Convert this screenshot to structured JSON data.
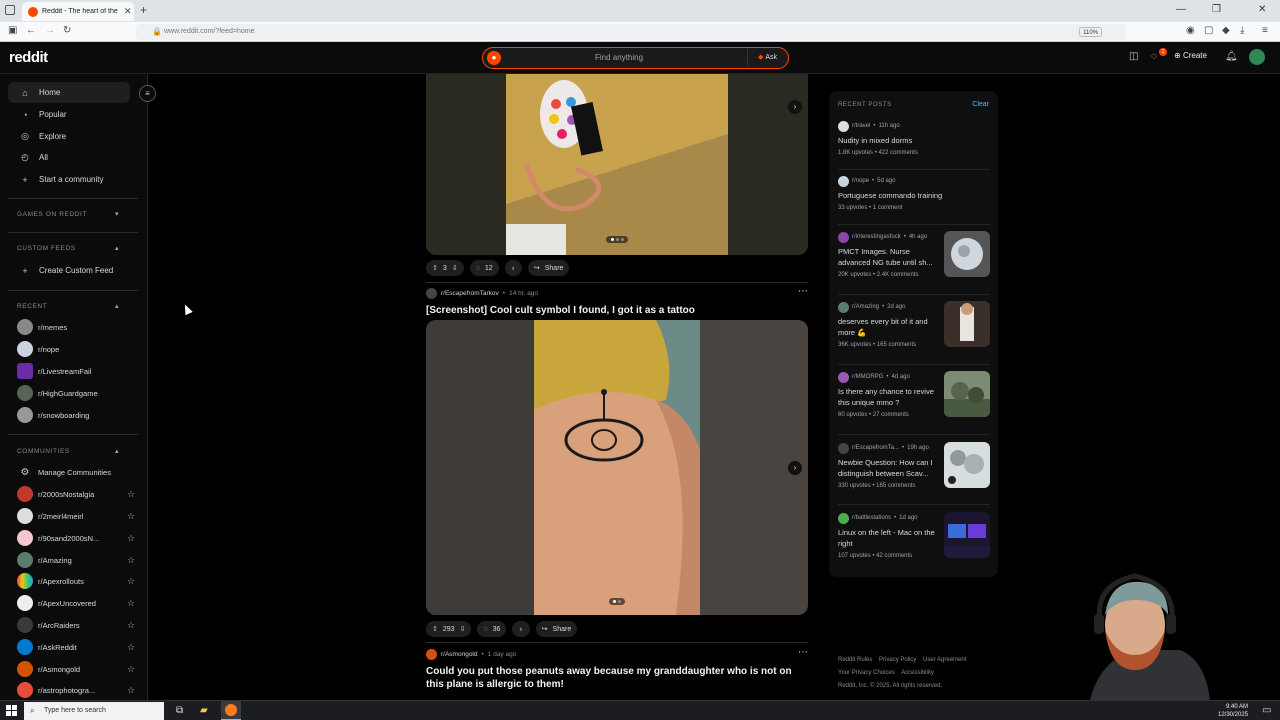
{
  "browser": {
    "tab_title": "Reddit - The heart of the intern",
    "url": "www.reddit.com/?feed=home",
    "zoom": "110%"
  },
  "header": {
    "logo": "reddit",
    "search_placeholder": "Find anything",
    "ask_label": "Ask",
    "create_label": "Create",
    "chat_badge": "1"
  },
  "sidebar": {
    "nav": [
      {
        "label": "Home"
      },
      {
        "label": "Popular"
      },
      {
        "label": "Explore"
      },
      {
        "label": "All"
      },
      {
        "label": "Start a community"
      }
    ],
    "games_header": "GAMES ON REDDIT",
    "custom_feeds_header": "CUSTOM FEEDS",
    "create_custom_feed": "Create Custom Feed",
    "recent_header": "RECENT",
    "recent": [
      {
        "label": "r/memes",
        "color": "#888888"
      },
      {
        "label": "r/nope",
        "color": "#c9d4e0"
      },
      {
        "label": "r/LivestreamFail",
        "color": "#6a2ca8"
      },
      {
        "label": "r/HighGuardgame",
        "color": "#556655"
      },
      {
        "label": "r/snowboarding",
        "color": "#999999"
      }
    ],
    "communities_header": "COMMUNITIES",
    "manage_communities": "Manage Communities",
    "communities": [
      {
        "label": "r/2000sNostalgia",
        "color": "#c0392b"
      },
      {
        "label": "r/2meirl4meirl",
        "color": "#dddddd"
      },
      {
        "label": "r/90sand2000sN...",
        "color": "#f5c6d0"
      },
      {
        "label": "r/Amazing",
        "color": "#5b7d6b"
      },
      {
        "label": "r/Apexrollouts",
        "color": "#e67e22"
      },
      {
        "label": "r/ApexUncovered",
        "color": "#eeeeee"
      },
      {
        "label": "r/ArcRaiders",
        "color": "#3a3a3a"
      },
      {
        "label": "r/AskReddit",
        "color": "#0079d3"
      },
      {
        "label": "r/Asmongold",
        "color": "#d35400"
      },
      {
        "label": "r/astrophotogra...",
        "color": "#e74c3c"
      }
    ]
  },
  "feed": {
    "post1": {
      "votes": "3",
      "comments": "12",
      "share": "Share"
    },
    "post2": {
      "subreddit": "r/EscapefromTarkov",
      "age": "14 hr. ago",
      "title": "[Screenshot] Cool cult symbol I found, I got it as a tattoo",
      "votes": "293",
      "comments": "36",
      "share": "Share"
    },
    "post3": {
      "subreddit": "r/Asmongold",
      "age": "1 day ago",
      "title": "Could you put those peanuts away because my granddaughter who is not on this plane is allergic to them!"
    }
  },
  "recent_posts": {
    "header": "RECENT POSTS",
    "clear": "Clear",
    "items": [
      {
        "sub": "r/travel",
        "age": "11h ago",
        "title": "Nudity in mixed dorms",
        "upvotes": "1.8K upvotes",
        "comments": "422 comments",
        "icon_color": "#dddddd"
      },
      {
        "sub": "r/nope",
        "age": "5d ago",
        "title": "Portuguese commando training",
        "upvotes": "33 upvotes",
        "comments": "1 comment",
        "icon_color": "#c9d4e0"
      },
      {
        "sub": "r/interestingasfuck",
        "age": "4h ago",
        "title": "PMCT Images. Nurse advanced NG tube until sh...",
        "upvotes": "20K upvotes",
        "comments": "2.4K comments",
        "icon_color": "#8e44ad"
      },
      {
        "sub": "r/Amazing",
        "age": "2d ago",
        "title": "deserves every bit of it and more 💪",
        "upvotes": "36K upvotes",
        "comments": "165 comments",
        "icon_color": "#5b7d6b"
      },
      {
        "sub": "r/MMORPG",
        "age": "4d ago",
        "title": "Is there any chance to revive this unique mmo ?",
        "upvotes": "60 upvotes",
        "comments": "27 comments",
        "icon_color": "#9b59b6"
      },
      {
        "sub": "r/EscapefromTa...",
        "age": "19h ago",
        "title": "Newbie Question: How can I distinguish between Scav...",
        "upvotes": "330 upvotes",
        "comments": "165 comments",
        "icon_color": "#444444"
      },
      {
        "sub": "r/battlestations",
        "age": "1d ago",
        "title": "Linux on the left - Mac on the right",
        "upvotes": "107 upvotes",
        "comments": "42 comments",
        "icon_color": "#4caf50"
      }
    ]
  },
  "footer": {
    "links_row1": [
      "Reddit Rules",
      "Privacy Policy",
      "User Agreement"
    ],
    "links_row2": [
      "Your Privacy Choices",
      "Accessibility"
    ],
    "copyright": "Reddit, Inc. © 2025. All rights reserved."
  },
  "taskbar": {
    "search_placeholder": "Type here to search",
    "time": "9:40 AM",
    "date": "12/30/2025"
  }
}
